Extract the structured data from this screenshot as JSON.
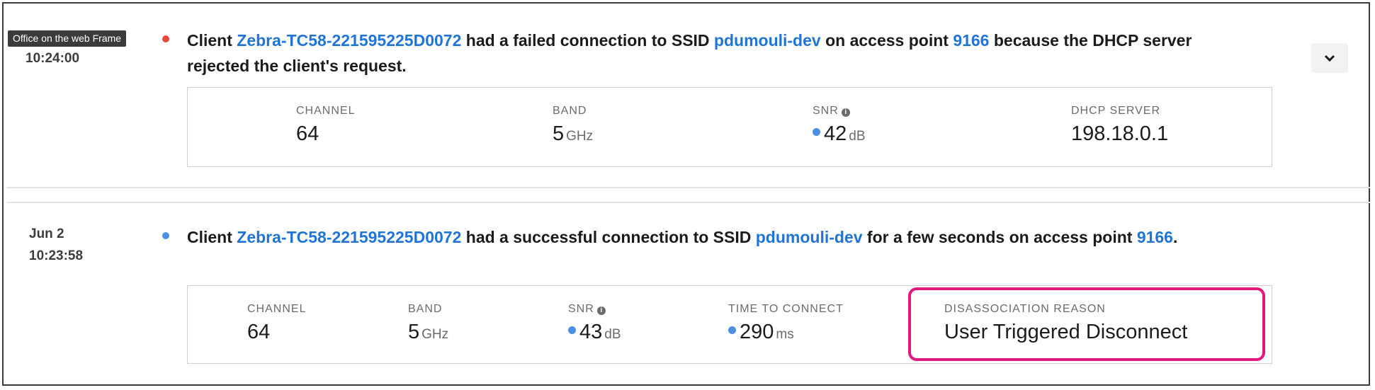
{
  "tooltip": "Office on the web Frame",
  "colors": {
    "link": "#1f74d6",
    "failed_dot": "#e8483b",
    "success_dot": "#4a90e2",
    "highlight": "#e0197f"
  },
  "events": [
    {
      "status": "failed",
      "date": "",
      "time": "10:24:00",
      "message": {
        "t1": "Client ",
        "client": "Zebra-TC58-221595225D0072",
        "t2": " had a failed connection to SSID ",
        "ssid": "pdumouli-dev",
        "t3": " on access point ",
        "ap": "9166",
        "t4": " because the DHCP server rejected the client's request."
      },
      "metrics": {
        "channel": {
          "label": "CHANNEL",
          "value": "64"
        },
        "band": {
          "label": "BAND",
          "value": "5",
          "unit": "GHz"
        },
        "snr": {
          "label": "SNR",
          "value": "42",
          "unit": "dB"
        },
        "dhcp": {
          "label": "DHCP SERVER",
          "value": "198.18.0.1"
        }
      }
    },
    {
      "status": "success",
      "date": "Jun 2",
      "time": "10:23:58",
      "message": {
        "t1": "Client ",
        "client": "Zebra-TC58-221595225D0072",
        "t2": " had a successful connection to SSID ",
        "ssid": "pdumouli-dev",
        "t3": " for a few seconds on access point ",
        "ap": "9166",
        "t4": "."
      },
      "metrics": {
        "channel": {
          "label": "CHANNEL",
          "value": "64"
        },
        "band": {
          "label": "BAND",
          "value": "5",
          "unit": "GHz"
        },
        "snr": {
          "label": "SNR",
          "value": "43",
          "unit": "dB"
        },
        "ttc": {
          "label": "TIME TO CONNECT",
          "value": "290",
          "unit": "ms"
        },
        "disassoc": {
          "label": "DISASSOCIATION REASON",
          "value": "User Triggered Disconnect"
        }
      }
    }
  ]
}
